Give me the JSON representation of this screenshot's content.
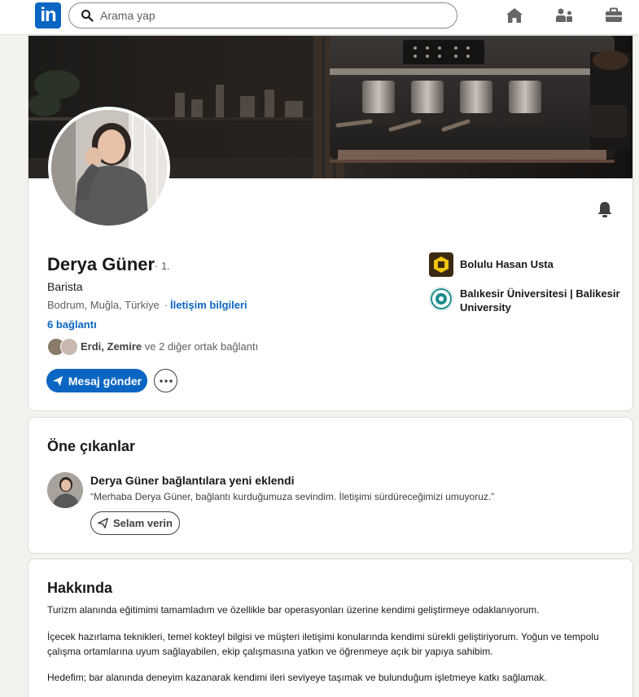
{
  "nav": {
    "logo_text": "in",
    "search_placeholder": "Arama yap",
    "icons": [
      "home-icon",
      "network-icon",
      "jobs-icon"
    ]
  },
  "profile": {
    "name": "Derya Güner",
    "degree": "· 1.",
    "headline": "Barista",
    "location": "Bodrum, Muğla, Türkiye",
    "location_sep": "·",
    "contact_link": "İletişim bilgileri",
    "connections": "6 bağlantı",
    "mutual_names": "Erdi, Zemire",
    "mutual_rest": " ve 2 diğer ortak bağlantı",
    "message_button": "Mesaj gönder",
    "organizations": [
      {
        "name": "Bolulu Hasan Usta",
        "color": "#f1c40f"
      },
      {
        "name": "Balıkesir Üniversitesi | Balikesir University",
        "color": "#1c8c8c"
      }
    ]
  },
  "highlights": {
    "title": "Öne çıkanlar",
    "item_title": "Derya Güner bağlantılara yeni eklendi",
    "item_text": "“Merhaba Derya Güner, bağlantı kurduğumuza sevindim. İletişimi sürdüreceğimizi umuyoruz.”",
    "button": "Selam verin"
  },
  "about": {
    "title": "Hakkında",
    "paragraphs": [
      "Turizm alanında eğitimimi tamamladım ve özellikle bar operasyonları üzerine kendimi geliştirmeye odaklanıyorum.",
      "İçecek hazırlama teknikleri, temel kokteyl bilgisi ve müşteri iletişimi konularında kendimi sürekli geliştiriyorum. Yoğun ve tempolu çalışma ortamlarına uyum sağlayabilen, ekip çalışmasına yatkın ve öğrenmeye açık bir yapıya sahibim.",
      "Hedefim; bar alanında deneyim kazanarak kendimi ileri seviyeye taşımak ve bulunduğum işletmeye katkı sağlamak."
    ]
  },
  "colors": {
    "brand": "#0a66c2",
    "background": "#f4f2ee"
  }
}
